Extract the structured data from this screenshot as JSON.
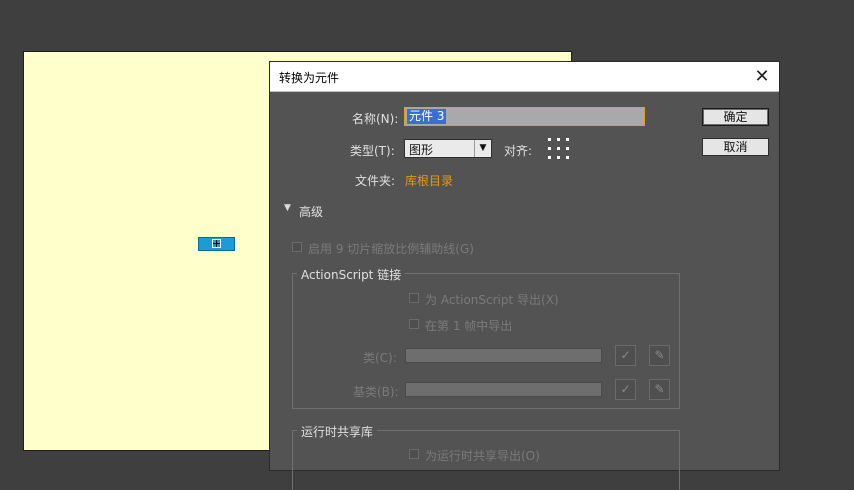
{
  "dialog": {
    "title": "转换为元件",
    "close_glyph": "✕",
    "name_label": "名称(N):",
    "name_value": "元件 3",
    "type_label": "类型(T):",
    "type_value": "图形",
    "align_label": "对齐:",
    "folder_label": "文件夹:",
    "folder_link": "库根目录",
    "ok_label": "确定",
    "cancel_label": "取消",
    "advanced_toggle": "▼",
    "advanced_label": "高级",
    "nine_slice_label": "启用 9 切片缩放比例辅助线(G)",
    "actionscript": {
      "legend": "ActionScript 链接",
      "export_as": "为 ActionScript 导出(X)",
      "export_frame1": "在第 1 帧中导出",
      "class_label": "类(C):",
      "base_class_label": "基类(B):"
    },
    "runtime_shared": {
      "legend": "运行时共享库",
      "export_runtime": "为运行时共享导出(O)"
    }
  },
  "icons": {
    "check": "✓",
    "pencil": "✎"
  },
  "colors": {
    "stage_bg": "#ffffcc",
    "dialog_bg": "#535353",
    "folder_link": "#e39a1c",
    "selection_blue": "#1d9bd6"
  }
}
